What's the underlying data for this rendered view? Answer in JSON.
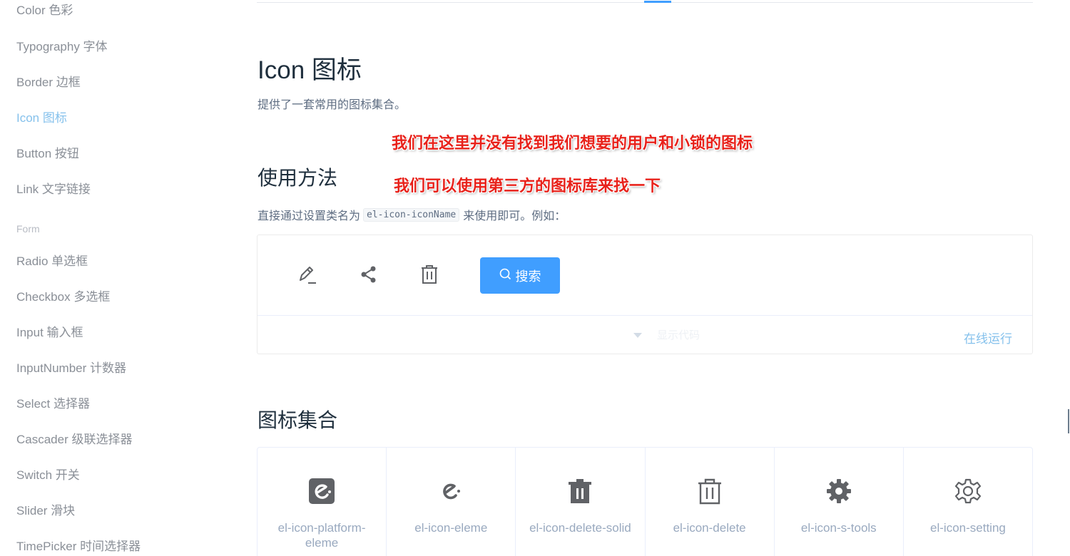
{
  "sidebar": {
    "items": [
      {
        "label": "Color 色彩"
      },
      {
        "label": "Typography 字体"
      },
      {
        "label": "Border 边框"
      },
      {
        "label": "Icon 图标"
      },
      {
        "label": "Button 按钮"
      },
      {
        "label": "Link 文字链接"
      }
    ],
    "group_form": "Form",
    "form_items": [
      {
        "label": "Radio 单选框"
      },
      {
        "label": "Checkbox 多选框"
      },
      {
        "label": "Input 输入框"
      },
      {
        "label": "InputNumber 计数器"
      },
      {
        "label": "Select 选择器"
      },
      {
        "label": "Cascader 级联选择器"
      },
      {
        "label": "Switch 开关"
      },
      {
        "label": "Slider 滑块"
      },
      {
        "label": "TimePicker 时间选择器"
      }
    ],
    "active": "Icon 图标"
  },
  "main": {
    "title": "Icon 图标",
    "description": "提供了一套常用的图标集合。",
    "usage_title": "使用方法",
    "usage_text_before": "直接通过设置类名为",
    "usage_code": "el-icon-iconName",
    "usage_text_after": "来使用即可。例如：",
    "demo": {
      "icons": [
        "edit-icon",
        "share-icon",
        "delete-icon"
      ],
      "search_button": "搜索",
      "expand_text": "显示代码",
      "run_link": "在线运行"
    },
    "collection_title": "图标集合",
    "collection": [
      {
        "icon": "platform-eleme-icon",
        "label": "el-icon-platform-eleme"
      },
      {
        "icon": "eleme-icon",
        "label": "el-icon-eleme"
      },
      {
        "icon": "delete-solid-icon",
        "label": "el-icon-delete-solid"
      },
      {
        "icon": "delete-icon",
        "label": "el-icon-delete"
      },
      {
        "icon": "s-tools-icon",
        "label": "el-icon-s-tools"
      },
      {
        "icon": "setting-icon",
        "label": "el-icon-setting"
      }
    ]
  },
  "annotations": {
    "line1": "我们在这里并没有找到我们想要的用户和小锁的图标",
    "line2": "我们可以使用第三方的图标库来找一下"
  },
  "colors": {
    "accent": "#409eff",
    "active_link": "#85c1ec",
    "annotation": "#e8221b"
  }
}
